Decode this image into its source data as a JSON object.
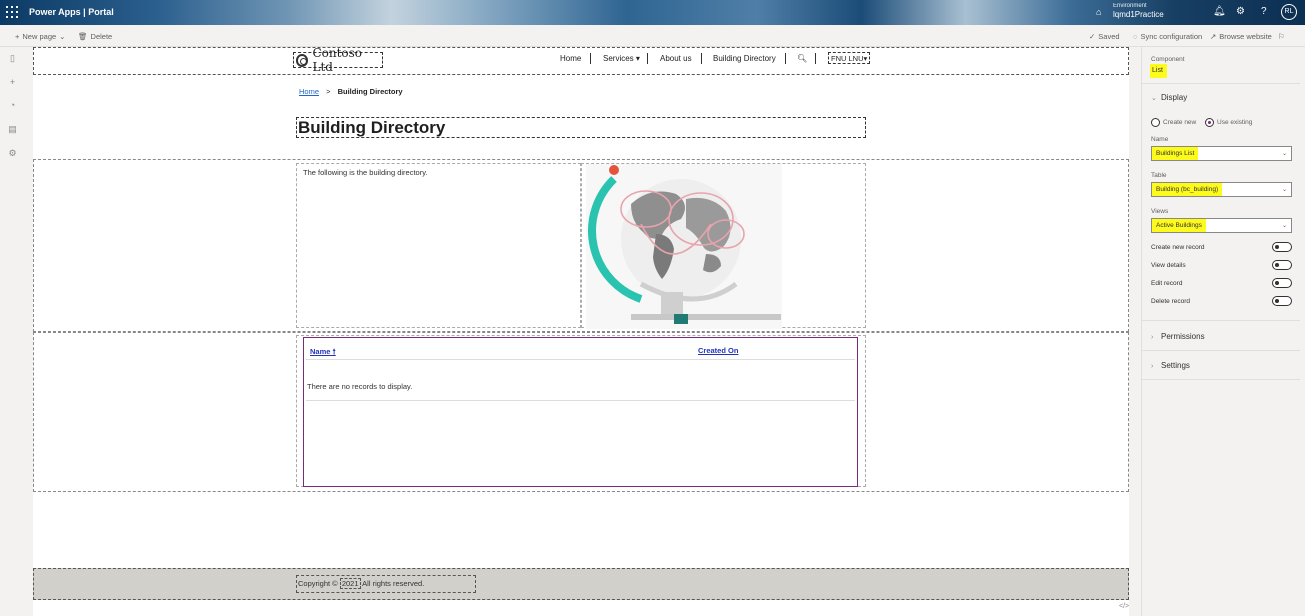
{
  "topbar": {
    "app_name": "Power Apps | Portal",
    "environment_label": "Environment",
    "environment_name": "lqmd1Practice",
    "avatar_initials": "RL",
    "icons": [
      "waffle-icon",
      "environment-icon",
      "bell-icon",
      "gear-icon",
      "help-icon"
    ]
  },
  "commandbar": {
    "new_page": "New page",
    "delete": "Delete",
    "saved": "Saved",
    "sync": "Sync configuration",
    "browse": "Browse website"
  },
  "site": {
    "logo_text": "Contoso Ltd",
    "nav": [
      "Home",
      "Services",
      "About us",
      "Building Directory"
    ],
    "user": "FNU LNU",
    "breadcrumb_home": "Home",
    "breadcrumb_sep": ">",
    "breadcrumb_current": "Building Directory",
    "page_title": "Building Directory",
    "intro_text": "The following is the building directory.",
    "list": {
      "col_name": "Name",
      "col_created": "Created On",
      "empty_message": "There are no records to display."
    },
    "copyright_prefix": "Copyright ©",
    "copyright_year": "2021",
    "copyright_suffix": "All rights reserved."
  },
  "panel": {
    "component_label": "Component",
    "component_value": "List",
    "display_section": "Display",
    "radio_create": "Create new",
    "radio_use": "Use existing",
    "name_label": "Name",
    "name_value": "Buildings List",
    "table_label": "Table",
    "table_value": "Building (bc_building)",
    "views_label": "Views",
    "views_value": "Active Buildings",
    "toggles": [
      "Create new record",
      "View details",
      "Edit record",
      "Delete record"
    ],
    "permissions": "Permissions",
    "settings": "Settings"
  },
  "colors": {
    "highlight": "#fdfb1c",
    "accent": "#7a2b7a"
  }
}
